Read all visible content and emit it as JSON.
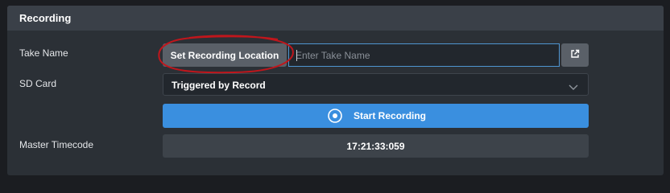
{
  "panel": {
    "title": "Recording"
  },
  "take_name": {
    "label": "Take Name",
    "set_location_button": "Set Recording Location",
    "input_value": "",
    "input_placeholder": "Enter Take Name",
    "external_icon": "external-link-icon"
  },
  "sd_card": {
    "label": "SD Card",
    "selected_value": "Triggered by Record",
    "chevron_icon": "chevron-down-icon"
  },
  "record": {
    "button_label": "Start Recording",
    "icon": "record-icon"
  },
  "master_timecode": {
    "label": "Master Timecode",
    "value": "17:21:33:059"
  },
  "colors": {
    "background": "#1b1d21",
    "panel": "#2b3036",
    "header": "#3a4048",
    "gray_button": "#5a6068",
    "accent_blue": "#3a8fdf",
    "annotation_red": "#c0161c"
  }
}
